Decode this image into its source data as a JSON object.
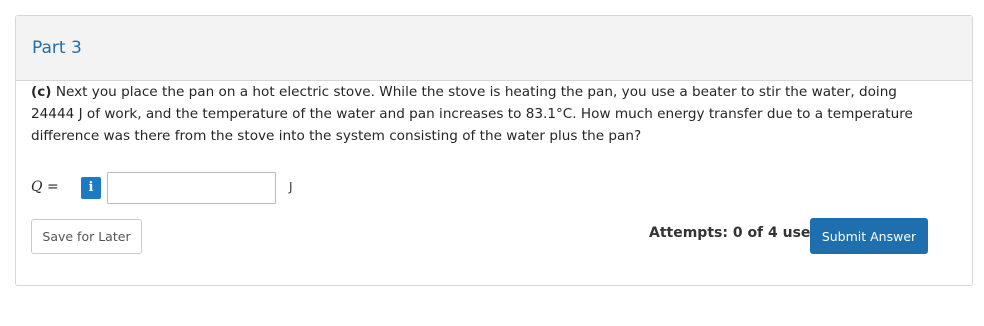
{
  "part": {
    "title": "Part 3"
  },
  "question": {
    "label": "(c)",
    "text": "Next you place the pan on a hot electric stove. While the stove is heating the pan, you use a beater to stir the water, doing 24444 J of work, and the temperature of the water and pan increases to 83.1°C. How much energy transfer due to a temperature difference was there from the stove into the system consisting of the water plus the pan?"
  },
  "answer": {
    "variable": "Q",
    "equals": "=",
    "info_glyph": "i",
    "value": "",
    "unit": "J"
  },
  "actions": {
    "save_label": "Save for Later",
    "attempts": "Attempts: 0 of 4 used",
    "submit_label": "Submit Answer"
  },
  "colors": {
    "accent": "#1f6fae",
    "info": "#1b7ac6",
    "header_bg": "#f3f3f3"
  }
}
